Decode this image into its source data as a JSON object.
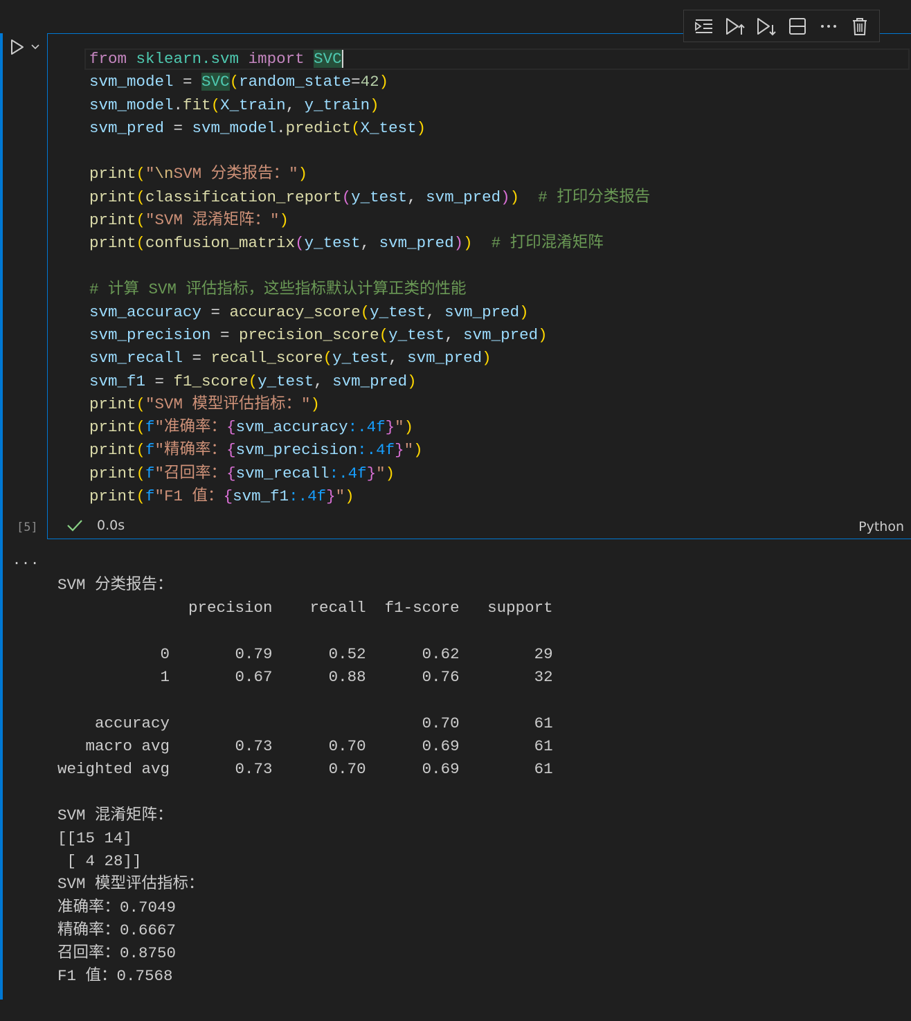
{
  "cell": {
    "execution_count": "[5]",
    "status_time": "0.0s",
    "language": "Python"
  },
  "toolbar": {
    "buttons": [
      "execute-above",
      "execute-cell-and-below",
      "execute-cell",
      "split-cell",
      "more-actions",
      "delete-cell"
    ]
  },
  "code": {
    "l1": {
      "a": "from",
      "b": " ",
      "c": "sklearn.svm",
      "d": " ",
      "e": "import",
      "f": " ",
      "g": "SVC"
    },
    "l2": {
      "a": "svm_model",
      "b": " = ",
      "c": "SVC",
      "d": "(",
      "e": "random_state",
      "f": "=",
      "g": "42",
      "h": ")"
    },
    "l3": {
      "a": "svm_model",
      "b": ".",
      "c": "fit",
      "d": "(",
      "e": "X_train",
      "f": ", ",
      "g": "y_train",
      "h": ")"
    },
    "l4": {
      "a": "svm_pred",
      "b": " = ",
      "c": "svm_model",
      "d": ".",
      "e": "predict",
      "f": "(",
      "g": "X_test",
      "h": ")"
    },
    "l6": {
      "a": "print",
      "b": "(",
      "c": "\"",
      "d": "\\n",
      "e": "SVM 分类报告：\"",
      "f": ")"
    },
    "l7": {
      "a": "print",
      "b": "(",
      "c": "classification_report",
      "d": "(",
      "e": "y_test",
      "f": ", ",
      "g": "svm_pred",
      "h": ")",
      "i": ")",
      "j": "  # 打印分类报告"
    },
    "l8": {
      "a": "print",
      "b": "(",
      "c": "\"SVM 混淆矩阵：\"",
      "d": ")"
    },
    "l9": {
      "a": "print",
      "b": "(",
      "c": "confusion_matrix",
      "d": "(",
      "e": "y_test",
      "f": ", ",
      "g": "svm_pred",
      "h": ")",
      "i": ")",
      "j": "  # 打印混淆矩阵"
    },
    "l11": {
      "a": "# 计算 SVM 评估指标，这些指标默认计算正类的性能"
    },
    "l12": {
      "a": "svm_accuracy",
      "b": " = ",
      "c": "accuracy_score",
      "d": "(",
      "e": "y_test",
      "f": ", ",
      "g": "svm_pred",
      "h": ")"
    },
    "l13": {
      "a": "svm_precision",
      "b": " = ",
      "c": "precision_score",
      "d": "(",
      "e": "y_test",
      "f": ", ",
      "g": "svm_pred",
      "h": ")"
    },
    "l14": {
      "a": "svm_recall",
      "b": " = ",
      "c": "recall_score",
      "d": "(",
      "e": "y_test",
      "f": ", ",
      "g": "svm_pred",
      "h": ")"
    },
    "l15": {
      "a": "svm_f1",
      "b": " = ",
      "c": "f1_score",
      "d": "(",
      "e": "y_test",
      "f": ", ",
      "g": "svm_pred",
      "h": ")"
    },
    "l16": {
      "a": "print",
      "b": "(",
      "c": "\"SVM 模型评估指标：\"",
      "d": ")"
    },
    "l17": {
      "a": "print",
      "b": "(",
      "c": "f",
      "d": "\"准确率：",
      "e": "{",
      "f": "svm_accuracy",
      "g": ":.4f",
      "h": "}",
      "i": "\"",
      "j": ")"
    },
    "l18": {
      "a": "print",
      "b": "(",
      "c": "f",
      "d": "\"精确率：",
      "e": "{",
      "f": "svm_precision",
      "g": ":.4f",
      "h": "}",
      "i": "\"",
      "j": ")"
    },
    "l19": {
      "a": "print",
      "b": "(",
      "c": "f",
      "d": "\"召回率：",
      "e": "{",
      "f": "svm_recall",
      "g": ":.4f",
      "h": "}",
      "i": "\"",
      "j": ")"
    },
    "l20": {
      "a": "print",
      "b": "(",
      "c": "f",
      "d": "\"F1 值：",
      "e": "{",
      "f": "svm_f1",
      "g": ":.4f",
      "h": "}",
      "i": "\"",
      "j": ")"
    }
  },
  "output": {
    "menu": "...",
    "lines": [
      "SVM 分类报告：",
      "              precision    recall  f1-score   support",
      "",
      "           0       0.79      0.52      0.62        29",
      "           1       0.67      0.88      0.76        32",
      "",
      "    accuracy                           0.70        61",
      "   macro avg       0.73      0.70      0.69        61",
      "weighted avg       0.73      0.70      0.69        61",
      "",
      "SVM 混淆矩阵：",
      "[[15 14]",
      " [ 4 28]]",
      "SVM 模型评估指标：",
      "准确率：0.7049",
      "精确率：0.6667",
      "召回率：0.8750",
      "F1 值：0.7568"
    ]
  },
  "colors": {
    "accent": "#0078d4",
    "background": "#1f1f1f",
    "success": "#89d185"
  }
}
